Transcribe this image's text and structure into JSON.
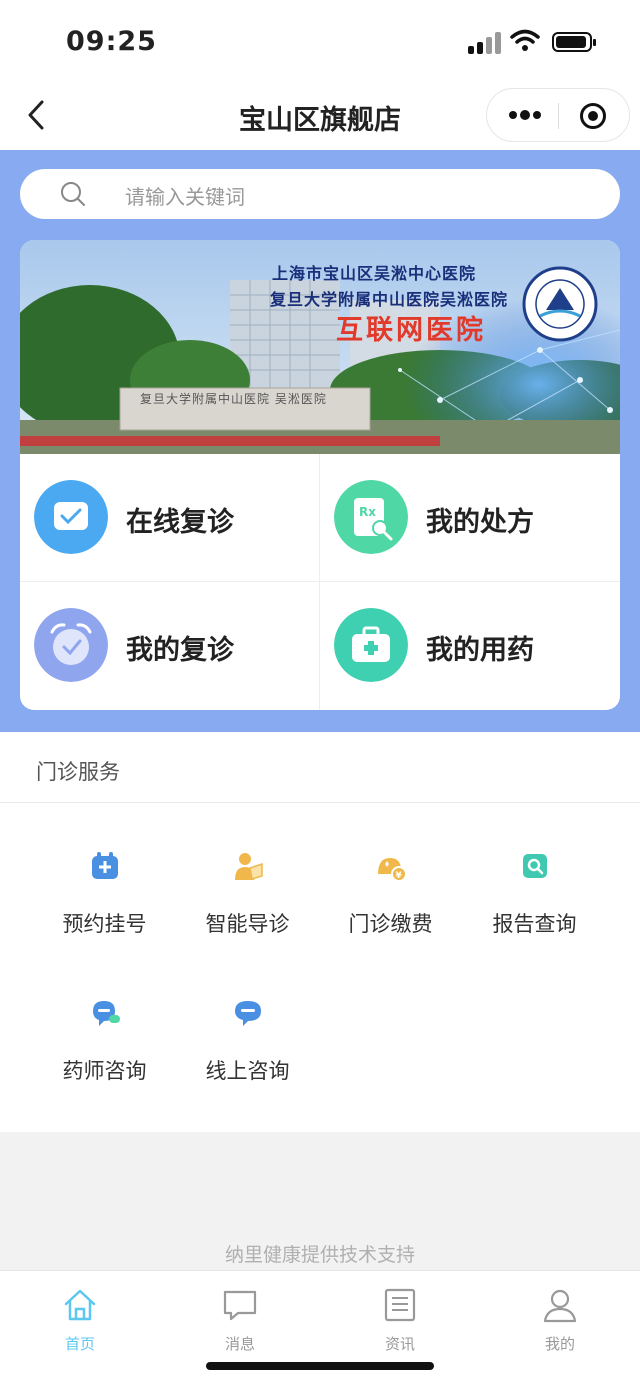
{
  "status_bar": {
    "time": "09:25"
  },
  "nav": {
    "title": "宝山区旗舰店"
  },
  "search": {
    "placeholder": "请输入关键词"
  },
  "banner": {
    "line1": "上海市宝山区吴淞中心医院",
    "line2": "复旦大学附属中山医院吴淞医院",
    "line3": "互联网医院",
    "sign": "复旦大学附属中山医院 吴淞医院"
  },
  "quick_entries": [
    {
      "label": "在线复诊",
      "icon": "chat-bubble-icon",
      "color": "#4aa9f0"
    },
    {
      "label": "我的处方",
      "icon": "prescription-icon",
      "color": "#4fd7a6"
    },
    {
      "label": "我的复诊",
      "icon": "alarm-clock-icon",
      "color": "#8fa6ef"
    },
    {
      "label": "我的用药",
      "icon": "medicine-kit-icon",
      "color": "#3ed0b0"
    }
  ],
  "services": {
    "header": "门诊服务",
    "items": [
      {
        "label": "预约挂号",
        "icon": "calendar-plus-icon",
        "color": "#4a90e2"
      },
      {
        "label": "智能导诊",
        "icon": "guide-person-icon",
        "color": "#f0b84a"
      },
      {
        "label": "门诊缴费",
        "icon": "payment-icon",
        "color": "#f0b84a"
      },
      {
        "label": "报告查询",
        "icon": "report-search-icon",
        "color": "#3ec9b0"
      },
      {
        "label": "药师咨询",
        "icon": "pharmacist-chat-icon",
        "color": "#4a90e2"
      },
      {
        "label": "线上咨询",
        "icon": "online-chat-icon",
        "color": "#4a90e2"
      }
    ]
  },
  "footer_note": "纳里健康提供技术支持",
  "tabbar": [
    {
      "label": "首页",
      "icon": "home-icon",
      "active": true
    },
    {
      "label": "消息",
      "icon": "message-icon",
      "active": false
    },
    {
      "label": "资讯",
      "icon": "news-icon",
      "active": false
    },
    {
      "label": "我的",
      "icon": "profile-icon",
      "active": false
    }
  ],
  "colors": {
    "accent": "#5cc8f0",
    "hero_bg": "#88aaf0"
  }
}
